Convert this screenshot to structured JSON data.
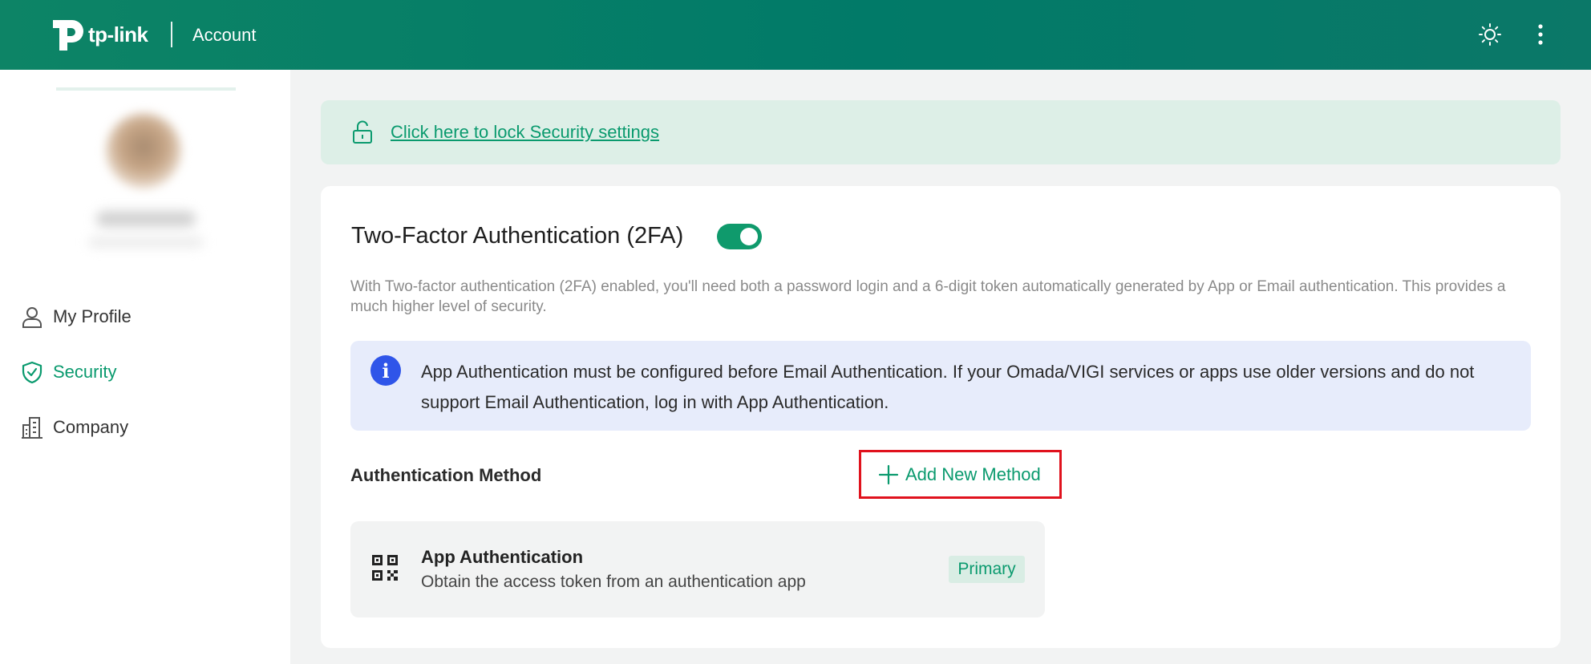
{
  "header": {
    "logo_text": "tp-link",
    "title": "Account",
    "theme_icon": "sun-icon",
    "menu_icon": "more-vertical-icon"
  },
  "sidebar": {
    "items": [
      {
        "label": "My Profile",
        "icon": "user-icon"
      },
      {
        "label": "Security",
        "icon": "shield-check-icon",
        "active": true
      },
      {
        "label": "Company",
        "icon": "building-icon"
      }
    ]
  },
  "lock_banner": {
    "icon": "unlock-icon",
    "link_text": "Click here to lock Security settings"
  },
  "tfa": {
    "title": "Two-Factor Authentication (2FA)",
    "enabled": true,
    "description": "With Two-factor authentication (2FA) enabled, you'll need both a password login and a 6-digit token automatically generated by App or Email authentication. This provides a much higher level of security.",
    "info": {
      "icon": "info-icon",
      "text": "App Authentication must be configured before Email Authentication. If your Omada/VIGI services or apps use older versions and do not support Email Authentication, log in with App Authentication."
    },
    "methods_label": "Authentication Method",
    "add_button_label": "Add New Method",
    "methods": [
      {
        "icon": "qr-code-icon",
        "title": "App Authentication",
        "subtitle": "Obtain the access token from an authentication app",
        "badge": "Primary"
      }
    ]
  },
  "colors": {
    "brand": "#0a9a6e",
    "header_bg": "#017a68",
    "highlight": "#e0121d",
    "info_bg": "#e7ecfb",
    "info_icon": "#2f55e9"
  }
}
